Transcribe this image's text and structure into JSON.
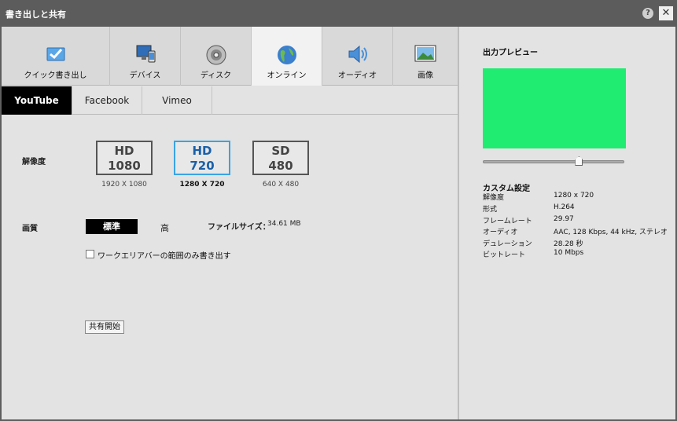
{
  "window": {
    "title": "書き出しと共有",
    "help": "?",
    "close": "✕"
  },
  "categories": [
    {
      "label": "クイック書き出し",
      "icon": "quick-export-icon"
    },
    {
      "label": "デバイス",
      "icon": "devices-icon"
    },
    {
      "label": "ディスク",
      "icon": "disc-icon"
    },
    {
      "label": "オンライン",
      "icon": "globe-icon",
      "active": true
    },
    {
      "label": "オーディオ",
      "icon": "speaker-icon"
    },
    {
      "label": "画像",
      "icon": "image-icon"
    }
  ],
  "subtabs": [
    {
      "label": "YouTube",
      "active": true
    },
    {
      "label": "Facebook"
    },
    {
      "label": "Vimeo"
    }
  ],
  "resolution": {
    "label": "解像度",
    "options": [
      {
        "line1": "HD",
        "line2": "1080",
        "caption": "1920 X 1080",
        "selected": false
      },
      {
        "line1": "HD",
        "line2": "720",
        "caption": "1280 X 720",
        "selected": true
      },
      {
        "line1": "SD",
        "line2": "480",
        "caption": "640 X 480",
        "selected": false
      }
    ]
  },
  "quality": {
    "label": "画質",
    "standard": "標準",
    "high": "高",
    "filesize_label": "ファイルサイズ：",
    "filesize_value": "34.61 MB"
  },
  "workarea_checkbox": {
    "label": "ワークエリアバーの範囲のみ書き出す",
    "checked": false
  },
  "share_button": "共有開始",
  "preview": {
    "title": "出力プレビュー",
    "screen_color": "#21ec72",
    "slider_position": 0.68
  },
  "custom_settings": {
    "title": "カスタム設定",
    "rows": [
      {
        "key": "解像度",
        "value": "1280 x 720"
      },
      {
        "key": "形式",
        "value": "H.264"
      },
      {
        "key": "フレームレート",
        "value": "29.97"
      },
      {
        "key": "オーディオ",
        "value": "AAC, 128 Kbps, 44 kHz, ステレオ"
      },
      {
        "key": "デュレーション",
        "value": "28.28 秒"
      },
      {
        "key": "ビットレート",
        "value": "10 Mbps"
      }
    ]
  }
}
